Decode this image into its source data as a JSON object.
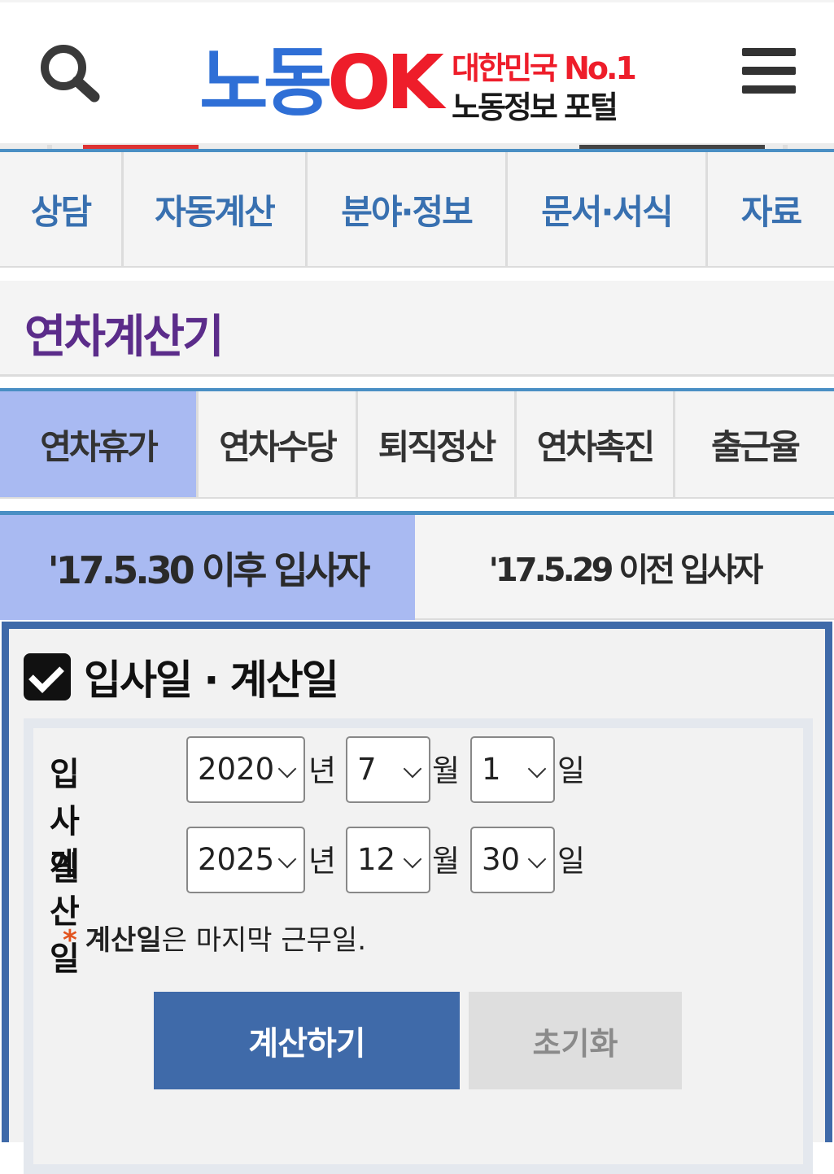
{
  "header": {
    "logo_main_part1": "노동",
    "logo_main_part2": "OK",
    "logo_sub1": "대한민국 No.1",
    "logo_sub2": "노동정보 포털"
  },
  "mainnav": [
    "상담",
    "자동계산",
    "분야·정보",
    "문서·서식",
    "자료"
  ],
  "page_title": "연차계산기",
  "calc_tabs": [
    {
      "label": "연차휴가",
      "active": true
    },
    {
      "label": "연차수당",
      "active": false
    },
    {
      "label": "퇴직정산",
      "active": false
    },
    {
      "label": "연차촉진",
      "active": false
    },
    {
      "label": "출근율",
      "active": false
    }
  ],
  "sub_tabs": [
    {
      "label": "'17.5.30 이후 입사자",
      "active": true
    },
    {
      "label": "'17.5.29 이전 입사자",
      "active": false
    }
  ],
  "section_title": "입사일 · 계산일",
  "start_date": {
    "label": "입사일",
    "year": "2020",
    "month": "7",
    "day": "1"
  },
  "calc_date": {
    "label": "계산일",
    "year": "2025",
    "month": "12",
    "day": "30"
  },
  "units": {
    "year": "년",
    "month": "월",
    "day": "일"
  },
  "note": {
    "star": "*",
    "bold": "계산일",
    "rest": "은 마지막 근무일."
  },
  "buttons": {
    "calculate": "계산하기",
    "reset": "초기화"
  },
  "colors": {
    "accent_blue": "#3f6aa9",
    "active_tab": "#a9baf2",
    "title_purple": "#5b2c8a",
    "nav_blue": "#3870b0"
  }
}
